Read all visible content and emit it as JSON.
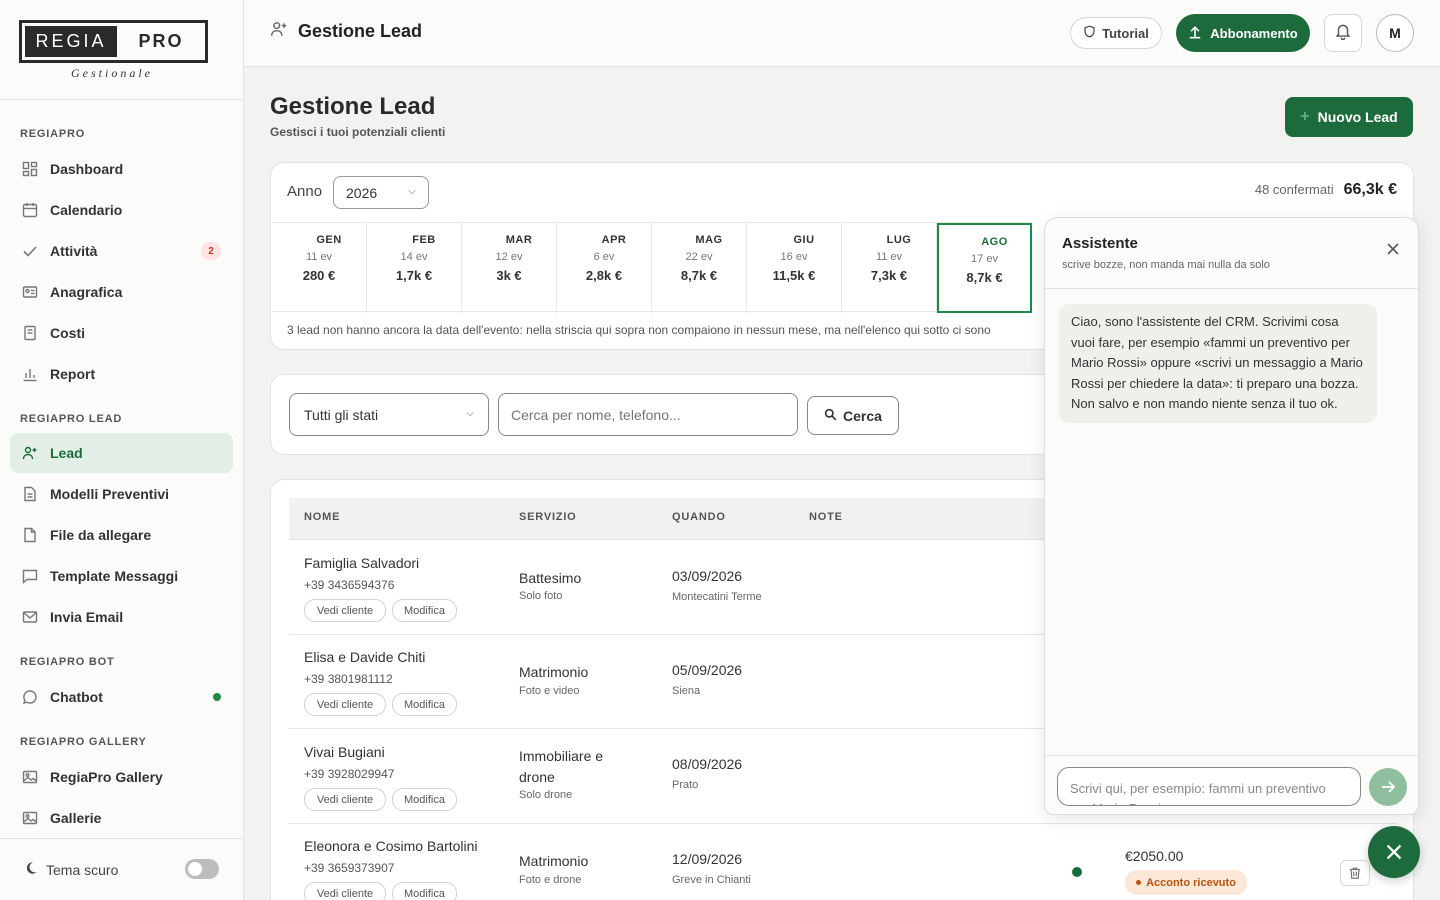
{
  "logo": {
    "left": "REGIA",
    "right": "PRO",
    "sub": "Gestionale"
  },
  "sidebar": {
    "sections": [
      "REGIAPRO",
      "REGIAPRO LEAD",
      "REGIAPRO BOT",
      "REGIAPRO GALLERY"
    ],
    "items": [
      {
        "label": "Dashboard",
        "icon": "dashboard-icon"
      },
      {
        "label": "Calendario",
        "icon": "calendar-icon"
      },
      {
        "label": "Attività",
        "icon": "check-icon",
        "badge": "2"
      },
      {
        "label": "Anagrafica",
        "icon": "id-card-icon"
      },
      {
        "label": "Costi",
        "icon": "receipt-icon"
      },
      {
        "label": "Report",
        "icon": "bar-chart-icon"
      },
      {
        "label": "Lead",
        "icon": "user-plus-icon",
        "active": true
      },
      {
        "label": "Modelli Preventivi",
        "icon": "document-icon"
      },
      {
        "label": "File da allegare",
        "icon": "file-icon"
      },
      {
        "label": "Template Messaggi",
        "icon": "message-icon"
      },
      {
        "label": "Invia Email",
        "icon": "mail-icon"
      },
      {
        "label": "Chatbot",
        "icon": "chat-icon",
        "status_color": "#1c8a45"
      },
      {
        "label": "RegiaPro Gallery",
        "icon": "image-icon"
      },
      {
        "label": "Gallerie",
        "icon": "images-icon"
      }
    ],
    "dark_theme_label": "Tema scuro"
  },
  "topbar": {
    "title": "Gestione Lead",
    "tutorial": "Tutorial",
    "abbonamento": "Abbonamento",
    "avatar": "M"
  },
  "page": {
    "title": "Gestione Lead",
    "subtitle": "Gestisci i tuoi potenziali clienti",
    "new_button": "Nuovo Lead"
  },
  "months_card": {
    "anno_label": "Anno",
    "anno_value": "2026",
    "confirmed_count": "48 confermati",
    "confirmed_total": "66,3k €",
    "months": [
      {
        "name": "GEN",
        "events": "11 ev",
        "value": "280 €"
      },
      {
        "name": "FEB",
        "events": "14 ev",
        "value": "1,7k €"
      },
      {
        "name": "MAR",
        "events": "12 ev",
        "value": "3k €"
      },
      {
        "name": "APR",
        "events": "6 ev",
        "value": "2,8k €"
      },
      {
        "name": "MAG",
        "events": "22 ev",
        "value": "8,7k €"
      },
      {
        "name": "GIU",
        "events": "16 ev",
        "value": "11,5k €"
      },
      {
        "name": "LUG",
        "events": "11 ev",
        "value": "7,3k €"
      },
      {
        "name": "AGO",
        "events": "17 ev",
        "value": "8,7k €",
        "active": true
      }
    ],
    "note": "3 lead non hanno ancora la data dell'evento: nella striscia qui sopra non compaiono in nessun mese, ma nell'elenco qui sotto ci sono"
  },
  "filters": {
    "status_select": "Tutti gli stati",
    "search_placeholder": "Cerca per nome, telefono...",
    "search_button": "Cerca"
  },
  "table": {
    "headers": [
      "NOME",
      "SERVIZIO",
      "QUANDO",
      "NOTE"
    ],
    "view_label": "Vedi cliente",
    "edit_label": "Modifica",
    "rows": [
      {
        "name": "Famiglia Salvadori",
        "phone": "+39 3436594376",
        "service": "Battesimo",
        "service_sub": "Solo foto",
        "date": "03/09/2026",
        "place": "Montecatini Terme"
      },
      {
        "name": "Elisa e Davide Chiti",
        "phone": "+39 3801981112",
        "service": "Matrimonio",
        "service_sub": "Foto e video",
        "date": "05/09/2026",
        "place": "Siena"
      },
      {
        "name": "Vivai Bugiani",
        "phone": "+39 3928029947",
        "service": "Immobiliare e drone",
        "service_sub": "Solo drone",
        "date": "08/09/2026",
        "place": "Prato"
      },
      {
        "name": "Eleonora e Cosimo Bartolini",
        "phone": "+39 3659373907",
        "service": "Matrimonio",
        "service_sub": "Foto e drone",
        "date": "12/09/2026",
        "place": "Greve in Chianti",
        "amount": "€2050.00",
        "status": "Acconto ricevuto"
      }
    ]
  },
  "assistant": {
    "title": "Assistente",
    "subtitle": "scrive bozze, non manda mai nulla da solo",
    "message": "Ciao, sono l'assistente del CRM. Scrivimi cosa vuoi fare, per esempio «fammi un preventivo per Mario Rossi» oppure «scrivi un messaggio a Mario Rossi per chiedere la data»: ti preparo una bozza. Non salvo e non mando niente senza il tuo ok.",
    "input_placeholder": "Scrivi qui, per esempio: fammi un preventivo per Mario Rossi"
  },
  "colors": {
    "primary": "#1d6b3c",
    "accent_light": "#e3eee6",
    "status_orange": "#b85410"
  }
}
